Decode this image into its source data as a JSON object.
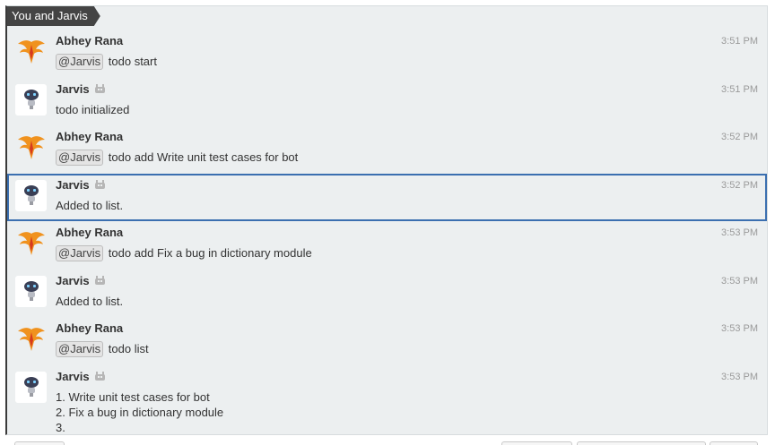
{
  "conversation": {
    "tab_label": "You and Jarvis"
  },
  "messages": [
    {
      "sender": "Abhey Rana",
      "type": "user",
      "time": "3:51 PM",
      "mention": "@Jarvis",
      "text": "todo start"
    },
    {
      "sender": "Jarvis",
      "type": "bot",
      "time": "3:51 PM",
      "text": "todo initialized"
    },
    {
      "sender": "Abhey Rana",
      "type": "user",
      "time": "3:52 PM",
      "mention": "@Jarvis",
      "text": "todo add Write unit test cases for bot"
    },
    {
      "sender": "Jarvis",
      "type": "bot",
      "time": "3:52 PM",
      "text": "Added to list.",
      "selected": true
    },
    {
      "sender": "Abhey Rana",
      "type": "user",
      "time": "3:53 PM",
      "mention": "@Jarvis",
      "text": "todo add Fix a bug in dictionary module"
    },
    {
      "sender": "Jarvis",
      "type": "bot",
      "time": "3:53 PM",
      "text": "Added to list."
    },
    {
      "sender": "Abhey Rana",
      "type": "user",
      "time": "3:53 PM",
      "mention": "@Jarvis",
      "text": "todo list"
    },
    {
      "sender": "Jarvis",
      "type": "bot",
      "time": "3:53 PM",
      "lines": [
        "1. Write unit test cases for bot",
        "2. Fix a bug in dictionary module",
        "3."
      ]
    }
  ],
  "icons": {
    "user_avatar": "phoenix-logo-icon",
    "bot_avatar": "robot-icon",
    "bot_tag": "bot-badge-icon"
  },
  "colors": {
    "selected_border": "#3b6fb0",
    "tab_background": "#444444",
    "panel_background": "#eceff0"
  }
}
